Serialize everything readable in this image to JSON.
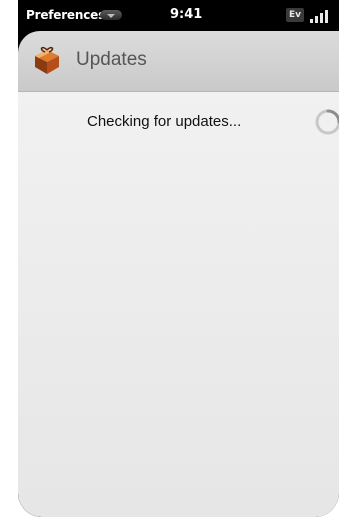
{
  "status_bar": {
    "app_menu_label": "Preferences",
    "time": "9:41",
    "network_label": "Ev"
  },
  "header": {
    "title": "Updates",
    "icon": "gift-icon"
  },
  "main": {
    "status_text": "Checking for updates...",
    "spinner_icon": "loading-spinner-icon"
  }
}
